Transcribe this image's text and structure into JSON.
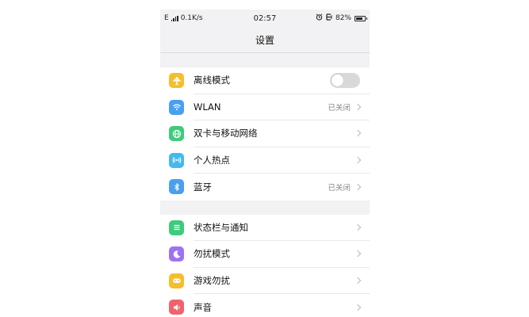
{
  "status_bar": {
    "network": "E",
    "speed": "0.1K/s",
    "time": "02:57",
    "battery_pct": "82%",
    "battery_level": 0.82
  },
  "nav": {
    "title": "设置"
  },
  "groups": [
    {
      "items": [
        {
          "label": "离线模式",
          "icon": "airplane-icon",
          "color": "#f6be2d",
          "control": "toggle",
          "toggle_on": false
        },
        {
          "label": "WLAN",
          "icon": "wifi-icon",
          "color": "#4a9ff0",
          "value": "已关闭"
        },
        {
          "label": "双卡与移动网络",
          "icon": "globe-icon",
          "color": "#3fca7c"
        },
        {
          "label": "个人热点",
          "icon": "hotspot-icon",
          "color": "#45b9ee"
        },
        {
          "label": "蓝牙",
          "icon": "bluetooth-icon",
          "color": "#4a9ff0",
          "value": "已关闭"
        }
      ]
    },
    {
      "items": [
        {
          "label": "状态栏与通知",
          "icon": "menu-icon",
          "color": "#3fca7c"
        },
        {
          "label": "勿扰模式",
          "icon": "moon-icon",
          "color": "#9f72f2"
        },
        {
          "label": "游戏勿扰",
          "icon": "gamepad-icon",
          "color": "#f6be2d"
        },
        {
          "label": "声音",
          "icon": "speaker-icon",
          "color": "#f0636c"
        }
      ]
    }
  ]
}
